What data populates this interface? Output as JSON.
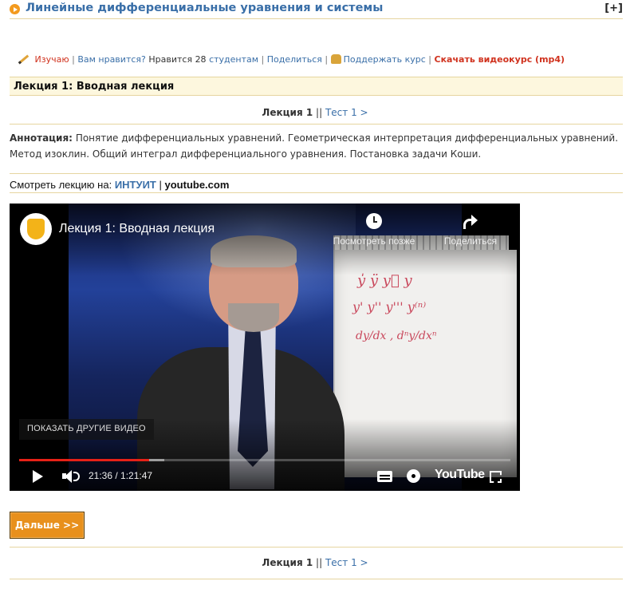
{
  "course": {
    "title": "Линейные дифференциальные уравнения и системы",
    "expand_label": "[+]"
  },
  "actions": {
    "studying": "Изучаю",
    "like_question": "Вам нравится?",
    "likes_prefix": "Нравится",
    "likes_count": "28",
    "likes_unit": "студентам",
    "share": "Поделиться",
    "support": "Поддержать курс",
    "download": "Скачать видеокурс (mp4)",
    "separator": "|"
  },
  "lecture": {
    "title": "Лекция 1: Вводная лекция"
  },
  "pager": {
    "current": "Лекция 1",
    "separator": "||",
    "test_link": "Тест 1 >"
  },
  "annotation": {
    "label": "Аннотация:",
    "text": "Понятие дифференциальных уравнений. Геометрическая интерпретация дифференциальных уравнений. Метод изоклин. Общий интеграл дифференциального уравнения. Постановка задачи Коши."
  },
  "watch": {
    "prefix": "Смотреть лекцию на:",
    "intuit": "ИНТУИТ",
    "separator": "|",
    "youtube": "youtube.com"
  },
  "video": {
    "title": "Лекция 1: Вводная лекция",
    "watch_later": "Посмотреть позже",
    "share": "Поделиться",
    "more_videos": "ПОКАЗАТЬ ДРУГИЕ ВИДЕО",
    "time": "21:36 / 1:21:47",
    "played_fraction": 0.264,
    "loaded_fraction": 0.295,
    "brand": "YouTube",
    "board_lines": [
      "y̍   ÿ   y⃛   y",
      "y'  y''  y'''  y⁽ⁿ⁾",
      "dy/dx ,  dⁿy/dxⁿ"
    ]
  },
  "next_button": "Дальше >>",
  "colors": {
    "link": "#3a6fa8",
    "accent_red": "#d0321e",
    "button_orange": "#e8901c",
    "rule": "#e6d5a0",
    "title_bar_bg": "#fdf7de",
    "progress_red": "#e62117"
  }
}
